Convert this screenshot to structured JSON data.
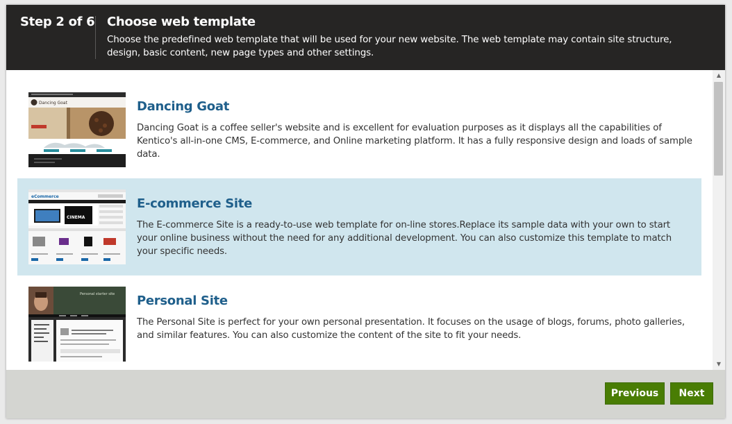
{
  "header": {
    "step": "Step 2 of 6",
    "title": "Choose web template",
    "subtitle": "Choose the predefined web template that will be used for your new website. The web template may contain site structure, design, basic content, new page types and other settings."
  },
  "templates": [
    {
      "name": "Dancing Goat",
      "description": "Dancing Goat is a coffee seller's website and is excellent for evaluation purposes as it displays all the capabilities of Kentico's all-in-one CMS, E-commerce, and Online marketing platform. It has a fully responsive design and loads of sample data.",
      "thumb_label": "Dancing Goat",
      "selected": false
    },
    {
      "name": "E-commerce Site",
      "description": "The E-commerce Site is a ready-to-use web template for on-line stores.Replace its sample data with your own to start your online business without the need for any additional development. You can also customize this template to match your specific needs.",
      "thumb_label": "eCommerce",
      "thumb_banner": "CINEMA",
      "selected": true
    },
    {
      "name": "Personal Site",
      "description": "The Personal Site is perfect for your own personal presentation. It focuses on the usage of blogs, forums, photo galleries, and similar features. You can also customize the content of the site to fit your needs.",
      "thumb_label": "Personal starter site",
      "selected": false
    }
  ],
  "footer": {
    "previous_label": "Previous",
    "next_label": "Next"
  },
  "colors": {
    "header_bg": "#262524",
    "selected_bg": "#d0e6ee",
    "link_title": "#1f5f8b",
    "button_bg": "#497d04",
    "footer_bg": "#d4d5d1"
  }
}
